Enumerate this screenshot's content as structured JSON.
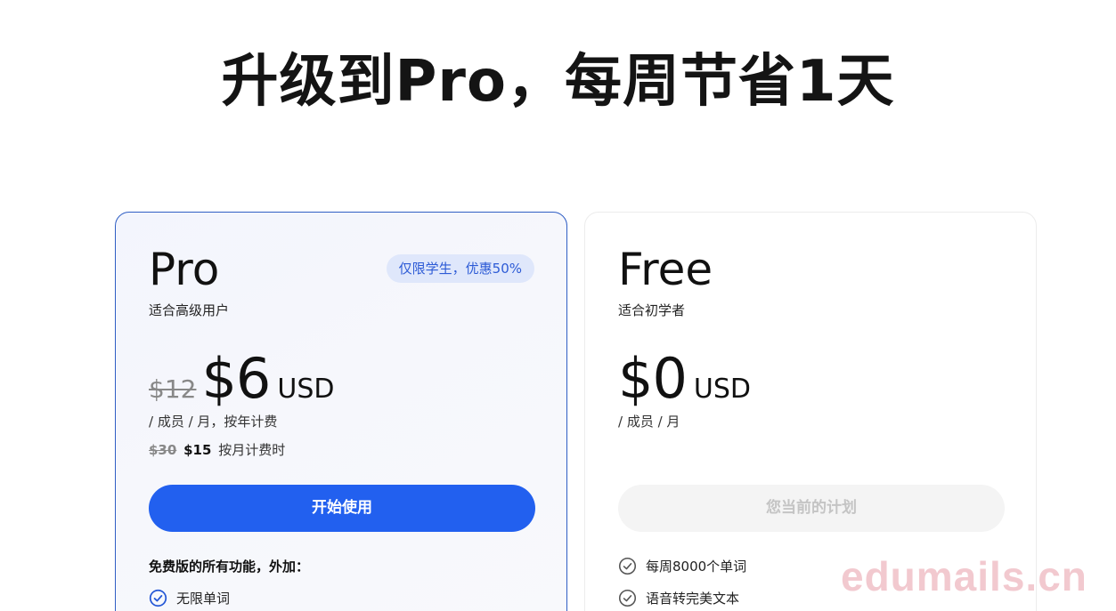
{
  "headline": "升级到Pro，每周节省1天",
  "plans": {
    "pro": {
      "name": "Pro",
      "description": "适合高级用户",
      "badge": "仅限学生，优惠50%",
      "old_price": "$12",
      "price": "$6",
      "currency": "USD",
      "billing": "/ 成员 / 月，按年计费",
      "monthly_old": "$30",
      "monthly_new": "$15",
      "monthly_suffix": "按月计费时",
      "cta_label": "开始使用",
      "features_title": "免费版的所有功能，外加：",
      "features": [
        "无限单词"
      ],
      "accent_color": "#2260ef"
    },
    "free": {
      "name": "Free",
      "description": "适合初学者",
      "price": "$0",
      "currency": "USD",
      "billing": "/ 成员 / 月",
      "cta_label": "您当前的计划",
      "features": [
        "每周8000个单词",
        "语音转完美文本"
      ]
    }
  },
  "watermark": "edumails.cn",
  "icons": {
    "check_pro": "check-circle-icon",
    "check_free": "check-circle-icon"
  }
}
